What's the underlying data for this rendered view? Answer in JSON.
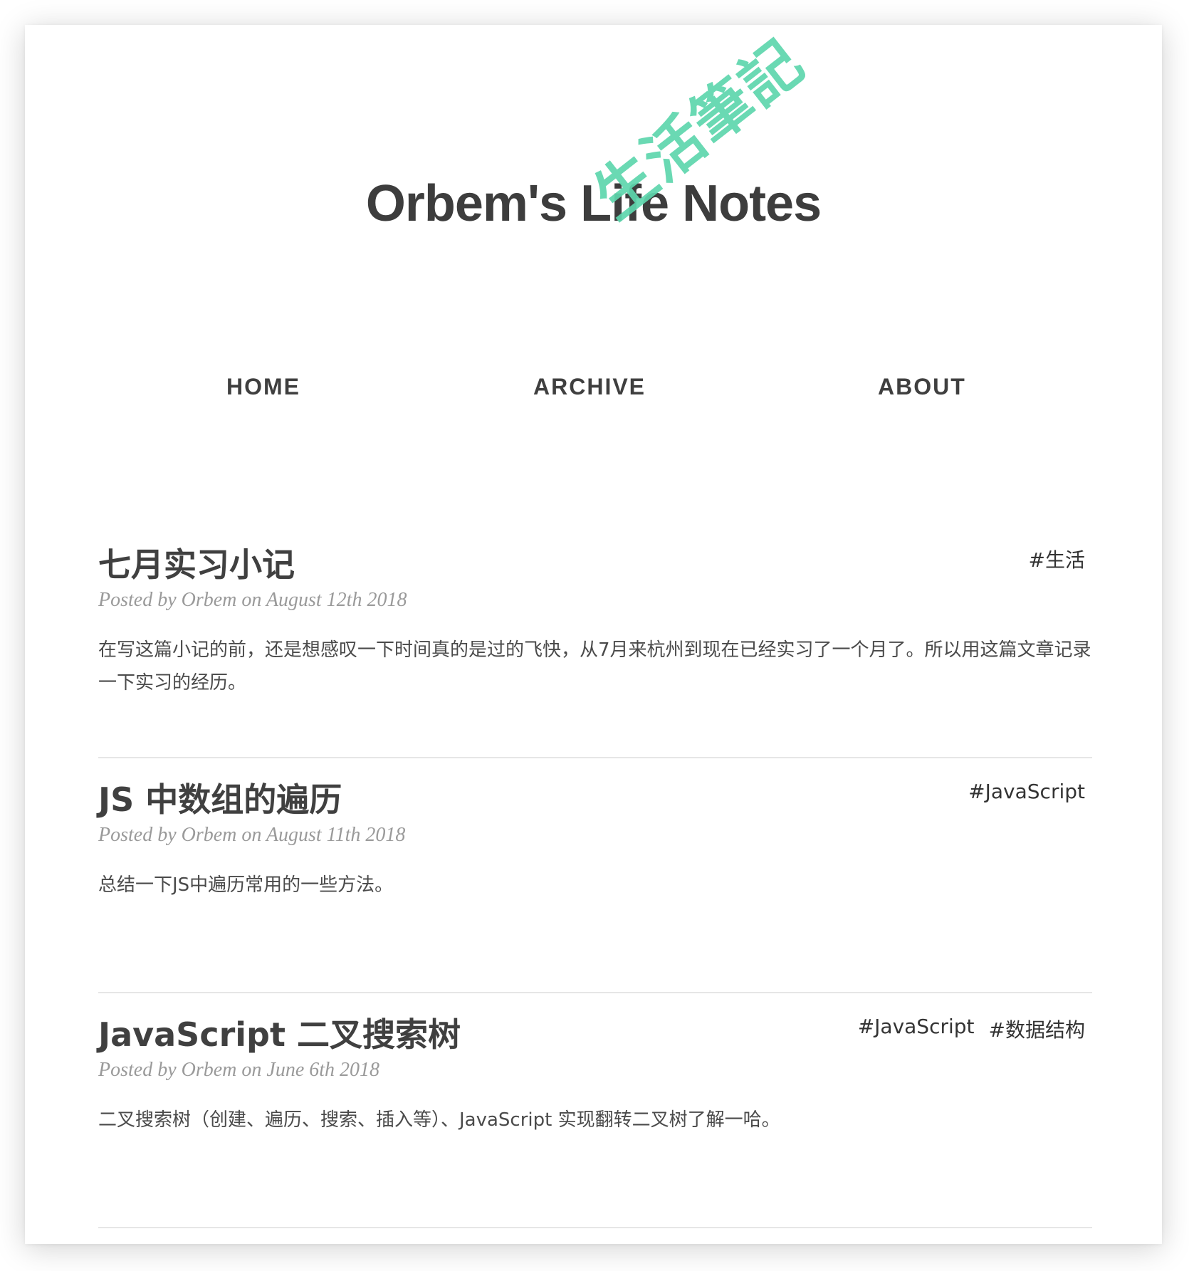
{
  "site": {
    "title": "Orbem's Life Notes",
    "subtitle": "生活筆記",
    "subtitle_color": "#5ed6ad"
  },
  "nav": {
    "home": "HOME",
    "archive": "ARCHIVE",
    "about": "ABOUT"
  },
  "posts": [
    {
      "title": "七月实习小记",
      "meta": "Posted by Orbem on August 12th 2018",
      "excerpt": "在写这篇小记的前，还是想感叹一下时间真的是过的飞快，从7月来杭州到现在已经实习了一个月了。所以用这篇文章记录一下实习的经历。",
      "tags": [
        "#生活"
      ]
    },
    {
      "title": "JS 中数组的遍历",
      "meta": "Posted by Orbem on August 11th 2018",
      "excerpt": "总结一下JS中遍历常用的一些方法。",
      "tags": [
        "#JavaScript"
      ]
    },
    {
      "title": "JavaScript 二叉搜索树",
      "meta": "Posted by Orbem on June 6th 2018",
      "excerpt": "二叉搜索树（创建、遍历、搜索、插入等）、JavaScript 实现翻转二叉树了解一哈。",
      "tags": [
        "#JavaScript",
        "#数据结构"
      ]
    }
  ]
}
